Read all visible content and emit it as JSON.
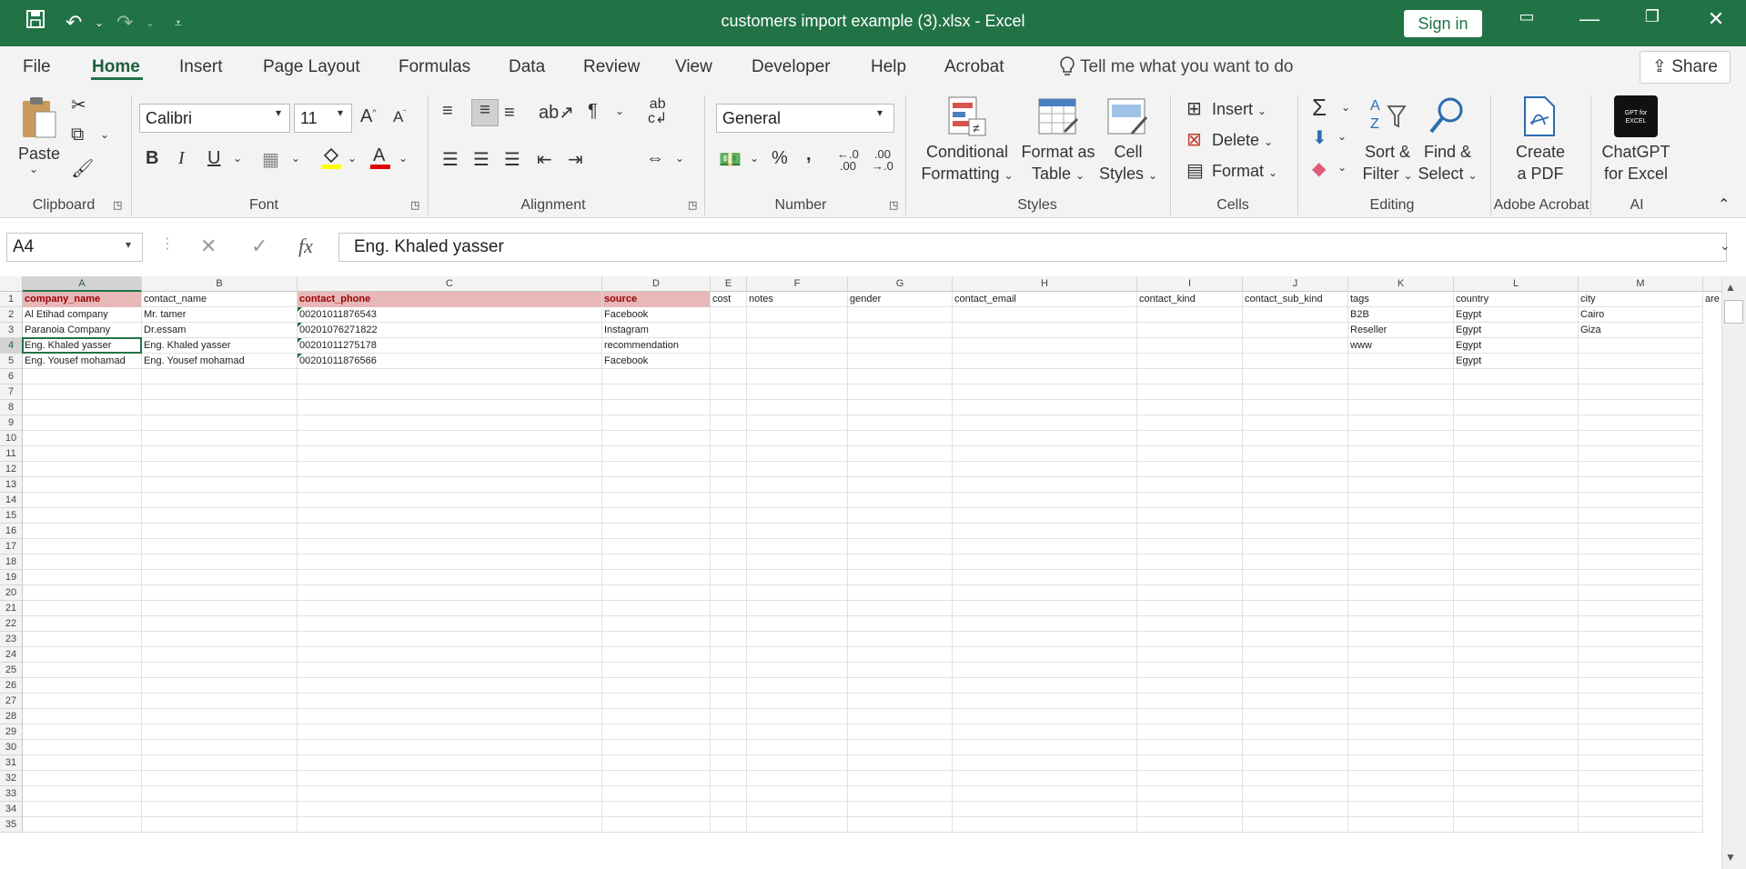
{
  "window": {
    "title": "customers import example (3).xlsx  -  Excel",
    "signin_label": "Sign in"
  },
  "quick_access": {
    "save_icon": "save-icon",
    "undo_icon": "undo-icon",
    "redo_icon": "redo-icon"
  },
  "tabs": [
    "File",
    "Home",
    "Insert",
    "Page Layout",
    "Formulas",
    "Data",
    "Review",
    "View",
    "Developer",
    "Help",
    "Acrobat"
  ],
  "active_tab": "Home",
  "tell_me": "Tell me what you want to do",
  "share_label": "Share",
  "ribbon": {
    "clipboard": {
      "label": "Clipboard",
      "paste": "Paste"
    },
    "font": {
      "label": "Font",
      "name": "Calibri",
      "size": "11"
    },
    "alignment": {
      "label": "Alignment"
    },
    "number": {
      "label": "Number",
      "format": "General"
    },
    "styles": {
      "label": "Styles",
      "conditional": [
        "Conditional",
        "Formatting"
      ],
      "format_table": [
        "Format as",
        "Table"
      ],
      "cell_styles": [
        "Cell",
        "Styles"
      ]
    },
    "cells": {
      "label": "Cells",
      "insert": "Insert",
      "delete": "Delete",
      "format": "Format"
    },
    "editing": {
      "label": "Editing",
      "sort": [
        "Sort &",
        "Filter"
      ],
      "find": [
        "Find &",
        "Select"
      ]
    },
    "acrobat": {
      "label": "Adobe Acrobat",
      "create": [
        "Create",
        "a PDF"
      ]
    },
    "ai": {
      "label": "AI",
      "chatgpt": [
        "ChatGPT",
        "for Excel"
      ],
      "logo_text": "GPT for EXCEL"
    }
  },
  "formula_bar": {
    "name_box": "A4",
    "fx": "fx",
    "content": "Eng. Khaled yasser"
  },
  "columns": [
    "A",
    "B",
    "C",
    "D",
    "E",
    "F",
    "G",
    "H",
    "I",
    "J",
    "K",
    "L",
    "M"
  ],
  "header_row": [
    "company_name",
    "contact_name",
    "contact_phone",
    "source",
    "cost",
    "notes",
    "gender",
    "contact_email",
    "contact_kind",
    "contact_sub_kind",
    "tags",
    "country",
    "city",
    "are"
  ],
  "rows": [
    [
      "Al Etihad company",
      "Mr. tamer",
      "00201011876543",
      "Facebook",
      "",
      "",
      "",
      "",
      "",
      "",
      "B2B",
      "Egypt",
      "Cairo"
    ],
    [
      "Paranoia Company",
      "Dr.essam",
      "00201076271822",
      "Instagram",
      "",
      "",
      "",
      "",
      "",
      "",
      "Reseller",
      "Egypt",
      "Giza"
    ],
    [
      "Eng. Khaled yasser",
      "Eng. Khaled yasser",
      "00201011275178",
      "recommendation",
      "",
      "",
      "",
      "",
      "",
      "",
      "www",
      "Egypt",
      ""
    ],
    [
      "Eng. Yousef mohamad",
      "Eng. Yousef mohamad",
      "00201011876566",
      "Facebook",
      "",
      "",
      "",
      "",
      "",
      "",
      "",
      "Egypt",
      ""
    ]
  ],
  "row_numbers": [
    "1",
    "2",
    "3",
    "4",
    "5",
    "6",
    "7",
    "8",
    "9",
    "10",
    "11",
    "12",
    "13",
    "14",
    "15",
    "16",
    "17",
    "18",
    "19",
    "20",
    "21",
    "22",
    "23",
    "24",
    "25",
    "26",
    "27",
    "28",
    "29",
    "30",
    "31",
    "32",
    "33",
    "34",
    "35"
  ],
  "selected_cell": "A4"
}
